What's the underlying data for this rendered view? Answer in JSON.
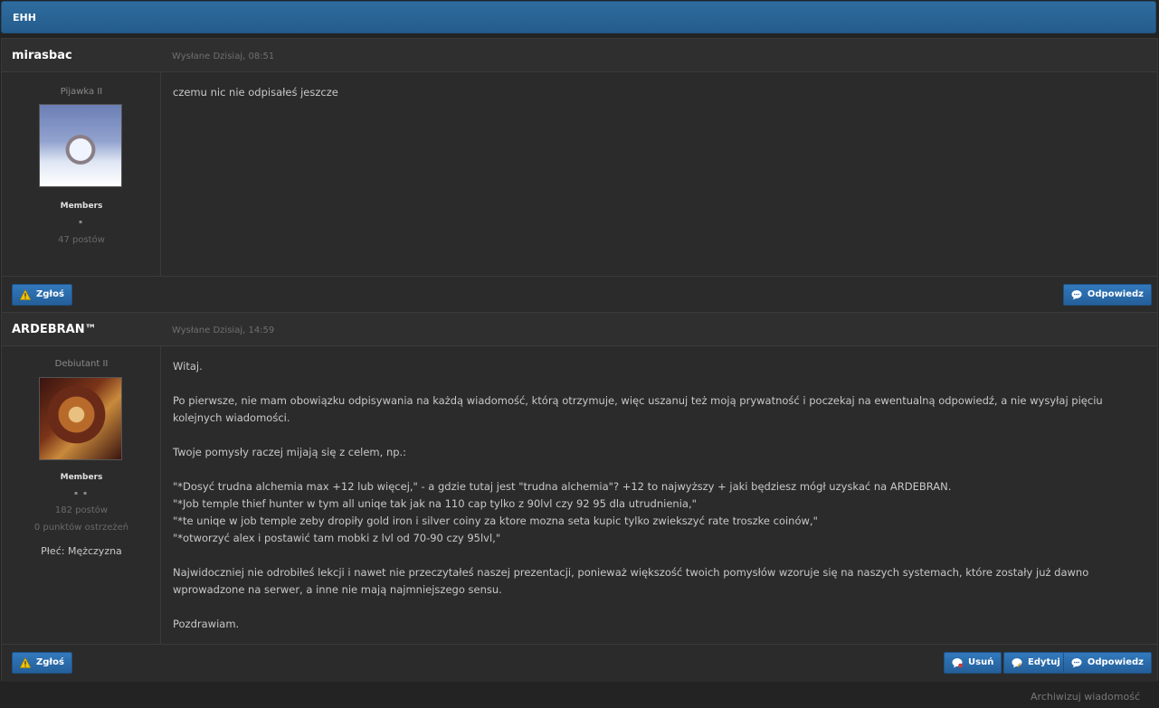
{
  "topic": {
    "title": "EHH"
  },
  "posts": [
    {
      "author": "mirasbac",
      "posted": "Wysłane Dzisiaj, 08:51",
      "rank": "Pijawka II",
      "group": "Members",
      "pips": "▪",
      "posts_count": "47 postów",
      "content": [
        "czemu nic nie odpisałeś jeszcze"
      ]
    },
    {
      "author": "ARDEBRAN™",
      "posted": "Wysłane Dzisiaj, 14:59",
      "rank": "Debiutant II",
      "group": "Members",
      "pips": "▪ ▪",
      "posts_count": "182 postów",
      "warnings": "0 punktów ostrzeżeń",
      "gender": "Płeć: Mężczyzna",
      "content": [
        "Witaj.",
        "Po pierwsze, nie mam obowiązku odpisywania na każdą wiadomość, którą otrzymuje, więc uszanuj też moją prywatność i poczekaj na ewentualną odpowiedź, a nie wysyłaj pięciu kolejnych wiadomości.",
        "Twoje pomysły raczej mijają się z celem, np.:",
        "\"*Dosyć trudna alchemia max +12 lub więcej,\" - a gdzie tutaj jest \"trudna alchemia\"? +12 to najwyższy + jaki będziesz mógł uzyskać na ARDEBRAN.",
        "\"*Job temple thief hunter w tym all uniqe tak jak na 110 cap tylko z 90lvl czy 92 95 dla utrudnienia,\"",
        "\"*te uniqe w job temple zeby dropiły gold iron i silver coiny za ktore mozna seta kupic tylko zwiekszyć rate troszke coinów,\"",
        "\"*otworzyć alex i postawić tam mobki z lvl od 70-90 czy 95lvl,\"",
        "Najwidoczniej nie odrobiłeś lekcji i nawet nie przeczytałeś naszej prezentacji, ponieważ większość twoich pomysłów wzoruje się na naszych systemach, które zostały już dawno wprowadzone na serwer, a inne nie mają najmniejszego sensu.",
        "Pozdrawiam."
      ]
    }
  ],
  "buttons": {
    "report": "Zgłoś",
    "reply": "Odpowiedz",
    "delete": "Usuń",
    "edit": "Edytuj"
  },
  "footer": {
    "archive": "Archiwizuj wiadomość"
  },
  "colors": {
    "accent": "#2a6fb0",
    "header": "#2a6496",
    "background": "#232323",
    "panel": "#2b2b2b"
  }
}
